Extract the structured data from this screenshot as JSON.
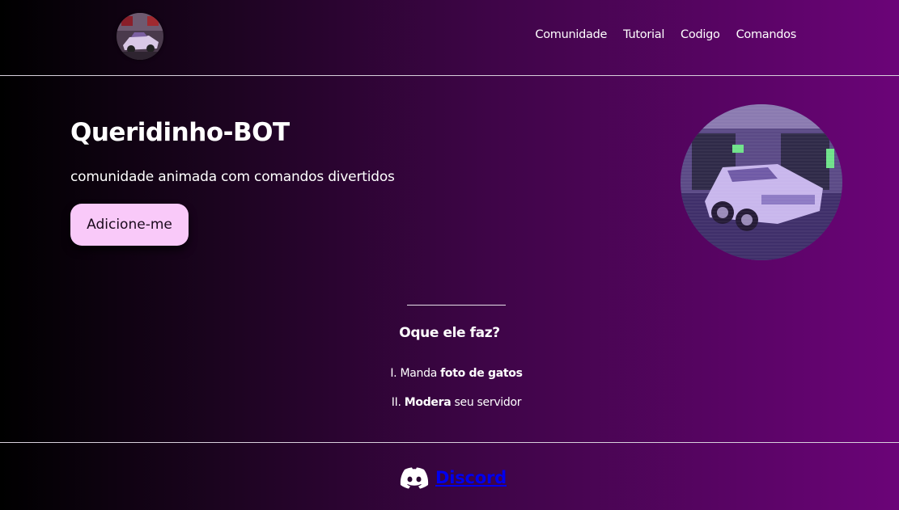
{
  "header": {
    "logo_alt": "car-avatar",
    "nav": [
      "Comunidade",
      "Tutorial",
      "Codigo",
      "Comandos"
    ]
  },
  "hero": {
    "title": "Queridinho-BOT",
    "subtitle": "comunidade animada com comandos divertidos",
    "cta_label": "Adicione-me"
  },
  "features": {
    "title": "Oque ele faz?",
    "items": [
      {
        "numeral": "I.",
        "pre": "Manda",
        "bold": "foto de gatos",
        "post": ""
      },
      {
        "numeral": "II.",
        "pre": "",
        "bold": "Modera",
        "post": "seu servidor"
      }
    ]
  },
  "footer": {
    "discord_label": "Discord"
  },
  "colors": {
    "bg_start": "#000000",
    "bg_end": "#6b0478",
    "button_bg": "#f9c9f9",
    "text": "#ffffff"
  }
}
